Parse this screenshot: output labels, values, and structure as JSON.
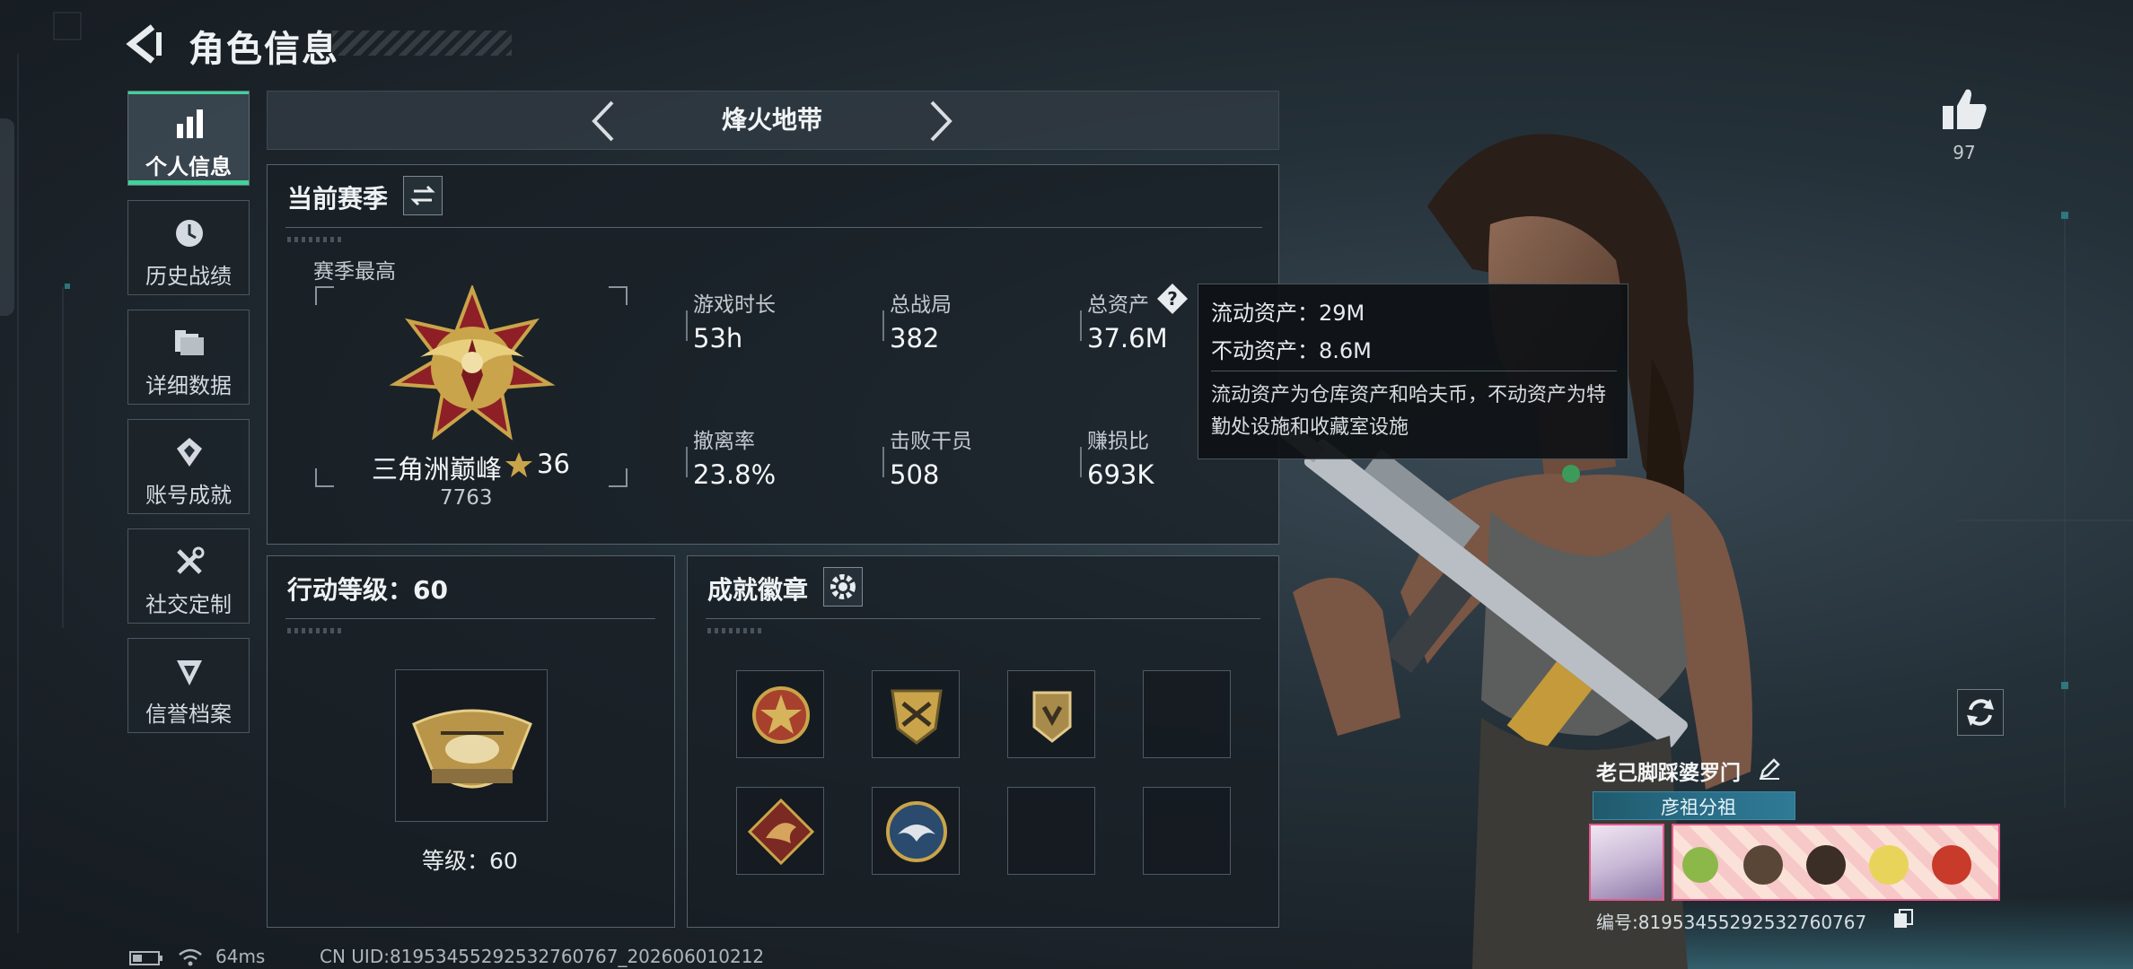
{
  "header": {
    "title": "角色信息"
  },
  "sidebar": {
    "items": [
      {
        "label": "个人信息",
        "icon": "bar-chart-icon",
        "active": true
      },
      {
        "label": "历史战绩",
        "icon": "history-icon",
        "active": false
      },
      {
        "label": "详细数据",
        "icon": "folder-icon",
        "active": false
      },
      {
        "label": "账号成就",
        "icon": "achievement-icon",
        "active": false
      },
      {
        "label": "社交定制",
        "icon": "wrench-icon",
        "active": false
      },
      {
        "label": "信誉档案",
        "icon": "credit-icon",
        "active": false
      }
    ]
  },
  "mode": {
    "title": "烽火地带"
  },
  "season": {
    "title": "当前赛季",
    "best_label": "赛季最高",
    "rank_name": "三角洲巅峰",
    "rank_stars": "36",
    "rank_score": "7763",
    "stats": [
      {
        "label": "游戏时长",
        "value": "53h"
      },
      {
        "label": "总战局",
        "value": "382"
      },
      {
        "label": "总资产",
        "value": "37.6M"
      },
      {
        "label": "撤离率",
        "value": "23.8%"
      },
      {
        "label": "击败干员",
        "value": "508"
      },
      {
        "label": "赚损比",
        "value": "693K"
      }
    ]
  },
  "tooltip": {
    "line1": "流动资产：29M",
    "line2": "不动资产：8.6M",
    "description": "流动资产为仓库资产和哈夫币，不动资产为特勤处设施和收藏室设施"
  },
  "level_panel": {
    "title": "行动等级：60",
    "level_text": "等级：60"
  },
  "badges_panel": {
    "title": "成就徽章",
    "filled_slots": 5,
    "total_slots": 8
  },
  "player": {
    "likes": "97",
    "name": "老己脚踩婆罗门",
    "title_plate": "彦祖分祖",
    "id_text": "编号:819534552925327607​67"
  },
  "footer": {
    "ping": "64ms",
    "uid": "CN UID:8195345529253276076​7_202606010212"
  },
  "colors": {
    "accent": "#3fd39a",
    "gold": "#c9a44a",
    "panel_border": "#56626c"
  }
}
